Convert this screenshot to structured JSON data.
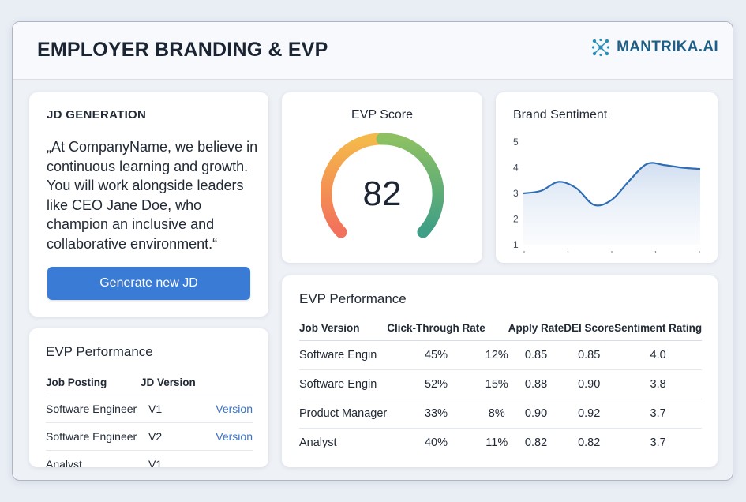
{
  "header": {
    "title": "EMPLOYER BRANDING & EVP",
    "brand_name": "MANTRIKA.AI",
    "brand_icon": "network-nodes-icon",
    "brand_color": "#1f5f86"
  },
  "jd_card": {
    "heading": "JD GENERATION",
    "text": "„At CompanyName, we believe in continuous learning and growth. You will work alongside leaders like CEO Jane Doe, who champion an inclusive and collaborative environment.“",
    "button_label": "Generate new JD",
    "button_color": "#3a7bd5"
  },
  "evp_score": {
    "title": "EVP Score",
    "value": "82",
    "gauge_colors": [
      "#f2705c",
      "#f5b94a",
      "#8cc063",
      "#3e9e86"
    ]
  },
  "brand_sentiment": {
    "title": "Brand Sentiment",
    "line_color": "#2f6db5"
  },
  "chart_data": {
    "type": "line",
    "title": "Brand Sentiment",
    "y_ticks": [
      "5",
      "4",
      "3",
      "2",
      "1"
    ],
    "ylim": [
      1,
      5
    ],
    "x_tick_count": 5,
    "x": [
      0,
      0.5,
      1,
      1.5,
      2,
      2.5,
      3,
      3.5,
      4,
      4.5,
      5
    ],
    "y": [
      3.0,
      3.1,
      3.45,
      3.2,
      2.55,
      2.75,
      3.5,
      4.15,
      4.1,
      4.0,
      3.95
    ],
    "grid": false
  },
  "evp_performance_small": {
    "title": "EVP Performance",
    "columns": [
      "Job Posting",
      "JD Version",
      ""
    ],
    "rows": [
      [
        "Software Engineer",
        "V1",
        "Version"
      ],
      [
        "Software Engineer",
        "V2",
        "Version"
      ],
      [
        "Analyst",
        "V1",
        ""
      ]
    ]
  },
  "evp_performance_big": {
    "title": "EVP Performance",
    "columns": [
      "Job Version",
      "Click-Through Rate",
      "",
      "Apply Rate",
      "DEI Score",
      "Sentiment Rating"
    ],
    "rows": [
      [
        "Software Engin",
        "45%",
        "12%",
        "0.85",
        "0.85",
        "4.0"
      ],
      [
        "Software Engin",
        "52%",
        "15%",
        "0.88",
        "0.90",
        "3.8"
      ],
      [
        "Product Manager",
        "33%",
        "8%",
        "0.90",
        "0.92",
        "3.7"
      ],
      [
        "Analyst",
        "40%",
        "11%",
        "0.82",
        "0.82",
        "3.7"
      ]
    ]
  }
}
